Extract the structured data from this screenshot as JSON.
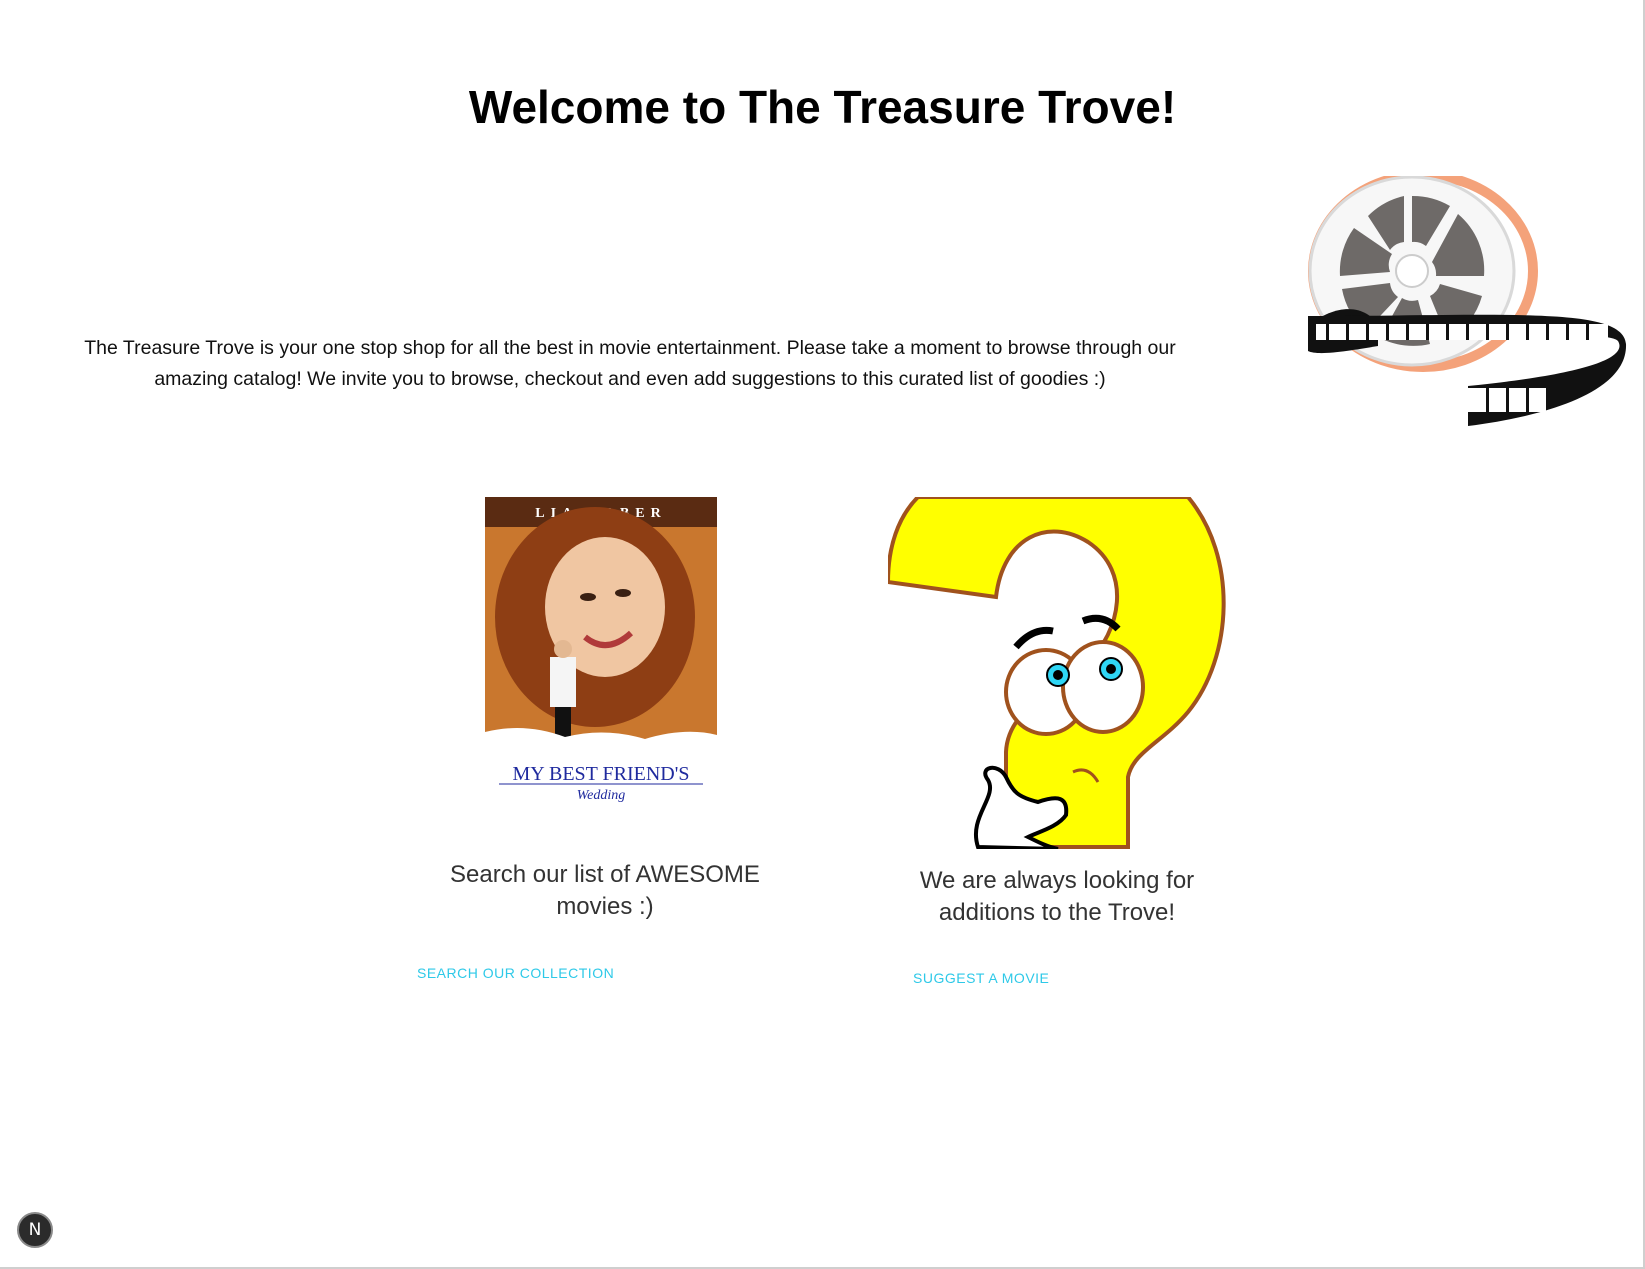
{
  "header": {
    "title": "Welcome to The Treasure Trove!"
  },
  "intro": {
    "text": "The Treasure Trove is your one stop shop for all the best in movie entertainment. Please take a moment to browse through our amazing catalog! We invite you to browse, checkout and even add suggestions to this curated list of goodies :)"
  },
  "decor": {
    "reel_icon": "film-reel-icon"
  },
  "cards": [
    {
      "image_icon": "movie-poster",
      "poster_top_text": "LIA ROBER",
      "poster_title": "MY BEST FRIEND'S",
      "poster_subtitle": "Wedding",
      "text": "Search our list of AWESOME movies :)",
      "link": "SEARCH OUR COLLECTION"
    },
    {
      "image_icon": "question-mark-cartoon",
      "text": "We are always looking for additions to the Trove!",
      "link": "SUGGEST A MOVIE"
    }
  ],
  "badge": {
    "label": "N"
  },
  "colors": {
    "link": "#2ec9e8",
    "question_yellow": "#ffff00",
    "question_outline": "#a0521d",
    "reel_accent": "#f4a27a"
  }
}
